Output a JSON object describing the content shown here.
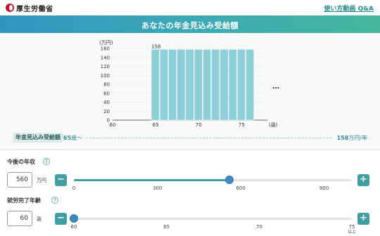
{
  "topbar": {
    "logo_text": "厚生労働省",
    "help_link": "使い方動画 Q&A"
  },
  "header": {
    "title": "あなたの年金見込み受給額"
  },
  "chart_data": {
    "type": "bar",
    "yunit": "(万円)",
    "xunit": "(歳)",
    "ylim": [
      0,
      160
    ],
    "yticks": [
      0,
      20,
      40,
      60,
      80,
      100,
      120,
      140,
      160
    ],
    "xlim": [
      60,
      78
    ],
    "xticks": [
      60,
      65,
      70,
      75
    ],
    "categories": [
      65,
      66,
      67,
      68,
      69,
      70,
      71,
      72,
      73,
      74,
      75,
      76
    ],
    "values": [
      158,
      158,
      158,
      158,
      158,
      158,
      158,
      158,
      158,
      158,
      158,
      158
    ],
    "data_label": "158",
    "bar_color": "#8ccfd8",
    "more_icon": "ellipsis-icon",
    "more_label": "…"
  },
  "result": {
    "label": "年金見込み受給額",
    "age_value": "65",
    "age_suffix": "歳〜",
    "amount_value": "158",
    "amount_suffix": "万円/年"
  },
  "income": {
    "label": "今後の年収",
    "help_icon": "question-icon",
    "help_glyph": "?",
    "value": "560",
    "unit": "万円",
    "minus": "−",
    "plus": "+",
    "min": 0,
    "max": 1000,
    "current": 560,
    "ticks": [
      "0",
      "300",
      "600",
      "900"
    ]
  },
  "work_age": {
    "label": "就労完了年齢",
    "help_icon": "question-icon",
    "help_glyph": "?",
    "value": "60",
    "unit": "歳",
    "minus": "−",
    "plus": "+",
    "min": 60,
    "max": 75,
    "current": 60,
    "ticks": [
      "60",
      "65",
      "70",
      "75"
    ],
    "last_tick_note": "以上"
  },
  "colors": {
    "accent": "#3e9ea2",
    "knob": "#3a89c2",
    "header_start": "#2f96c0",
    "header_end": "#44b79c"
  }
}
